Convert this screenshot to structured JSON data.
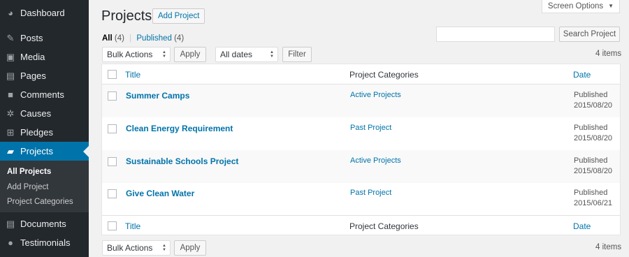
{
  "sidebar": {
    "items": [
      {
        "label": "Dashboard",
        "icon": "dashboard-icon",
        "glyph": "◕"
      },
      {
        "label": "Posts",
        "icon": "pin-icon",
        "glyph": "✎"
      },
      {
        "label": "Media",
        "icon": "media-icon",
        "glyph": "▣"
      },
      {
        "label": "Pages",
        "icon": "pages-icon",
        "glyph": "▤"
      },
      {
        "label": "Comments",
        "icon": "comments-icon",
        "glyph": "■"
      },
      {
        "label": "Causes",
        "icon": "causes-icon",
        "glyph": "✲"
      },
      {
        "label": "Pledges",
        "icon": "cart-icon",
        "glyph": "⊞"
      },
      {
        "label": "Projects",
        "icon": "folder-icon",
        "glyph": "▰"
      },
      {
        "label": "Documents",
        "icon": "documents-icon",
        "glyph": "▤"
      },
      {
        "label": "Testimonials",
        "icon": "testimonials-icon",
        "glyph": "●"
      }
    ],
    "submenu": [
      "All Projects",
      "Add Project",
      "Project Categories"
    ]
  },
  "header": {
    "title": "Projects",
    "add_button": "Add Project",
    "screen_options": "Screen Options"
  },
  "filters": {
    "all_label": "All",
    "all_count": "(4)",
    "sep": "|",
    "published_label": "Published",
    "published_count": "(4)"
  },
  "search": {
    "value": "",
    "button": "Search Project"
  },
  "toolbar_top": {
    "bulk_actions": "Bulk Actions",
    "apply": "Apply",
    "dates": "All dates",
    "filter": "Filter",
    "items": "4 items"
  },
  "toolbar_bottom": {
    "bulk_actions": "Bulk Actions",
    "apply": "Apply",
    "items": "4 items"
  },
  "table": {
    "columns": {
      "title": "Title",
      "categories": "Project Categories",
      "date": "Date"
    },
    "rows": [
      {
        "title": "Summer Camps",
        "category": "Active Projects",
        "status": "Published",
        "date": "2015/08/20"
      },
      {
        "title": "Clean Energy Requirement",
        "category": "Past Project",
        "status": "Published",
        "date": "2015/08/20"
      },
      {
        "title": "Sustainable Schools Project",
        "category": "Active Projects",
        "status": "Published",
        "date": "2015/08/20"
      },
      {
        "title": "Give Clean Water",
        "category": "Past Project",
        "status": "Published",
        "date": "2015/06/21"
      }
    ]
  },
  "colors": {
    "sidebar": "#23282d",
    "active": "#0073aa",
    "link": "#0073aa"
  }
}
